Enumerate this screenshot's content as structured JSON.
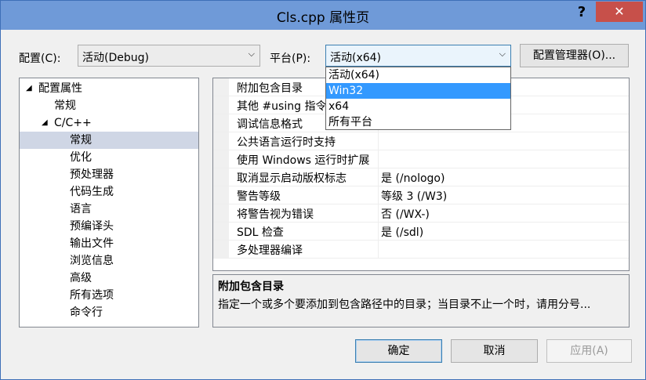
{
  "window": {
    "title": "Cls.cpp 属性页",
    "help_label": "?",
    "close_label": "✕"
  },
  "config": {
    "label": "配置(C):",
    "value": "活动(Debug)"
  },
  "platform": {
    "label": "平台(P):",
    "value": "活动(x64)",
    "options": [
      "活动(x64)",
      "Win32",
      "x64",
      "所有平台"
    ],
    "highlighted_index": 1
  },
  "config_manager_label": "配置管理器(O)...",
  "tree": {
    "items": [
      {
        "label": "配置属性",
        "expander": "◢",
        "level": 0
      },
      {
        "label": "常规",
        "expander": "",
        "level": 1
      },
      {
        "label": "C/C++",
        "expander": "◢",
        "level": 1
      },
      {
        "label": "常规",
        "expander": "",
        "level": 2,
        "selected": true
      },
      {
        "label": "优化",
        "expander": "",
        "level": 2
      },
      {
        "label": "预处理器",
        "expander": "",
        "level": 2
      },
      {
        "label": "代码生成",
        "expander": "",
        "level": 2
      },
      {
        "label": "语言",
        "expander": "",
        "level": 2
      },
      {
        "label": "预编译头",
        "expander": "",
        "level": 2
      },
      {
        "label": "输出文件",
        "expander": "",
        "level": 2
      },
      {
        "label": "浏览信息",
        "expander": "",
        "level": 2
      },
      {
        "label": "高级",
        "expander": "",
        "level": 2
      },
      {
        "label": "所有选项",
        "expander": "",
        "level": 2
      },
      {
        "label": "命令行",
        "expander": "",
        "level": 2
      }
    ]
  },
  "properties": [
    {
      "name": "附加包含目录",
      "value": ""
    },
    {
      "name": "其他 #using 指令",
      "value": ""
    },
    {
      "name": "调试信息格式",
      "value": ""
    },
    {
      "name": "公共语言运行时支持",
      "value": ""
    },
    {
      "name": "使用 Windows 运行时扩展",
      "value": ""
    },
    {
      "name": "取消显示启动版权标志",
      "value": "是 (/nologo)"
    },
    {
      "name": "警告等级",
      "value": "等级 3 (/W3)"
    },
    {
      "name": "将警告视为错误",
      "value": "否 (/WX-)"
    },
    {
      "name": "SDL 检查",
      "value": "是 (/sdl)"
    },
    {
      "name": "多处理器编译",
      "value": ""
    }
  ],
  "description": {
    "title": "附加包含目录",
    "text": "指定一个或多个要添加到包含路径中的目录；当目录不止一个时，请用分号..."
  },
  "buttons": {
    "ok": "确定",
    "cancel": "取消",
    "apply": "应用(A)"
  }
}
